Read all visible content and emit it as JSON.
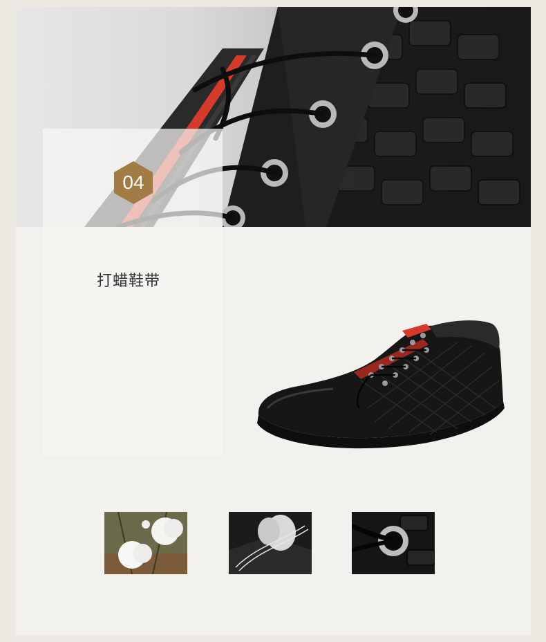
{
  "feature": {
    "number": "04",
    "title": "打蜡鞋带"
  },
  "colors": {
    "badge": "#a27c45",
    "page_background": "#ece9e2",
    "panel_background": "#f3f1ed",
    "lace_stripe_red": "#d53a2a"
  },
  "images": {
    "hero": "closeup-waxed-laces-eyelets",
    "product": "black-woven-leather-sneaker",
    "thumbnails": [
      "cotton-bolls",
      "hand-waxing-lace",
      "lace-through-eyelet"
    ]
  }
}
